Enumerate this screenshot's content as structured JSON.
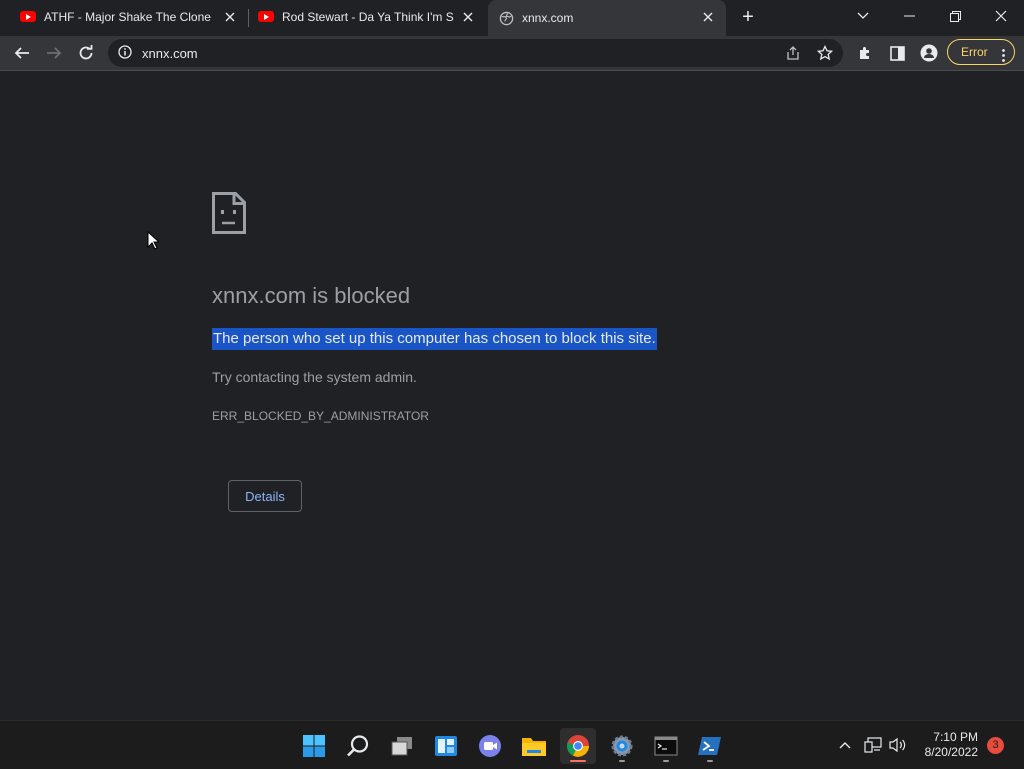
{
  "browser": {
    "tabs": [
      {
        "title": "ATHF - Major Shake The Clone - ",
        "favicon": "youtube-icon",
        "active": false
      },
      {
        "title": "Rod Stewart - Da Ya Think I'm Se",
        "favicon": "youtube-icon",
        "active": false
      },
      {
        "title": "xnnx.com",
        "favicon": "globe-icon",
        "active": true
      }
    ],
    "new_tab_label": "+",
    "address": "xnnx.com",
    "error_label": "Error",
    "colors": {
      "error_accent": "#fdd663",
      "tab_active": "#35363a",
      "background": "#202124"
    }
  },
  "page": {
    "heading": "xnnx.com is blocked",
    "description": "The person who set up this computer has chosen to block this site.",
    "hint": "Try contacting the system admin.",
    "error_code": "ERR_BLOCKED_BY_ADMINISTRATOR",
    "details_button": "Details",
    "selection_color": "#1a55c8",
    "link_color": "#8ab4f8"
  },
  "taskbar": {
    "apps": [
      "start-icon",
      "search-icon",
      "task-view-icon",
      "widgets-icon",
      "teams-chat-icon",
      "file-explorer-icon",
      "chrome-icon",
      "settings-icon",
      "terminal-icon",
      "powershell-icon"
    ],
    "time": "7:10 PM",
    "date": "8/20/2022",
    "notification_count": "3"
  }
}
